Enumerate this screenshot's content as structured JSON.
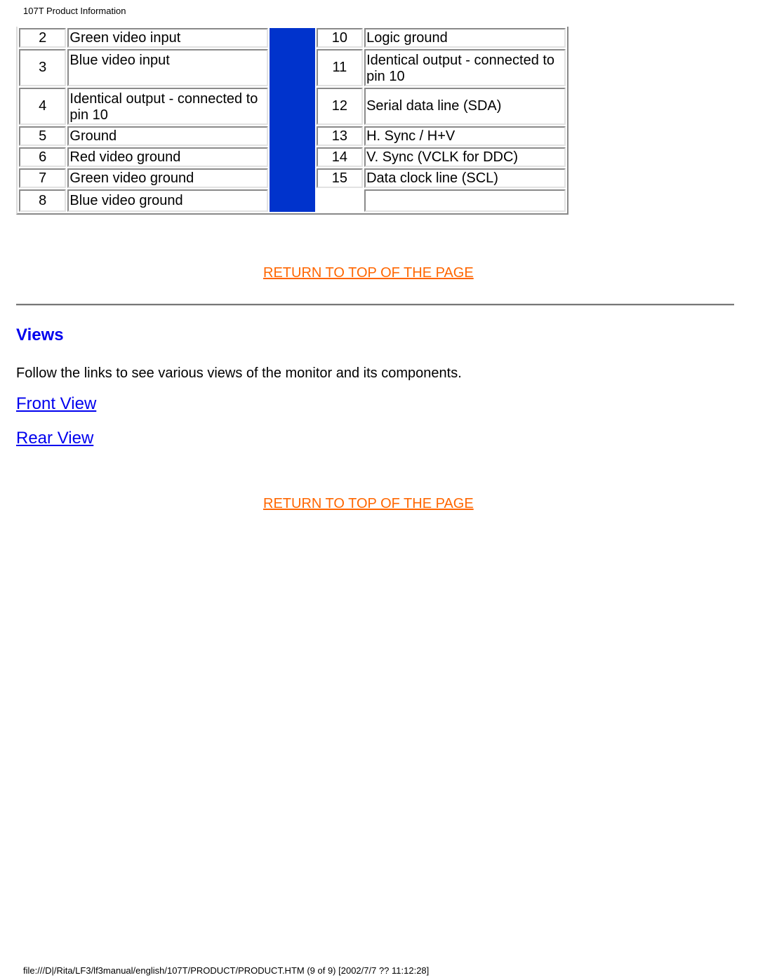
{
  "header": {
    "title": "107T Product Information"
  },
  "pin_table": {
    "left_rows": [
      {
        "pin": "2",
        "description": "Green video input"
      },
      {
        "pin": "3",
        "description": "Blue video input"
      },
      {
        "pin": "4",
        "description": "Identical output - connected to pin 10"
      },
      {
        "pin": "5",
        "description": "Ground"
      },
      {
        "pin": "6",
        "description": "Red video ground"
      },
      {
        "pin": "7",
        "description": "Green video ground"
      },
      {
        "pin": "8",
        "description": "Blue video ground"
      }
    ],
    "right_rows": [
      {
        "pin": "10",
        "description": "Logic ground"
      },
      {
        "pin": "11",
        "description": "Identical output - connected to pin 10"
      },
      {
        "pin": "12",
        "description": "Serial data line (SDA)"
      },
      {
        "pin": "13",
        "description": "H. Sync / H+V"
      },
      {
        "pin": "14",
        "description": "V. Sync (VCLK for DDC)"
      },
      {
        "pin": "15",
        "description": "Data clock line (SCL)"
      },
      {
        "pin": "",
        "description": ""
      }
    ],
    "spacer_color": "#0033CC"
  },
  "links": {
    "return_top_1": "RETURN TO TOP OF THE PAGE",
    "return_top_2": "RETURN TO TOP OF THE PAGE",
    "link_color": "#FF6600"
  },
  "views": {
    "title": "Views",
    "intro": "Follow the links to see various views of the monitor and its components.",
    "front_view": "Front View",
    "rear_view": "Rear View"
  },
  "footer": {
    "path": "file:///D|/Rita/LF3/lf3manual/english/107T/PRODUCT/PRODUCT.HTM (9 of 9) [2002/7/7 ?? 11:12:28]"
  }
}
